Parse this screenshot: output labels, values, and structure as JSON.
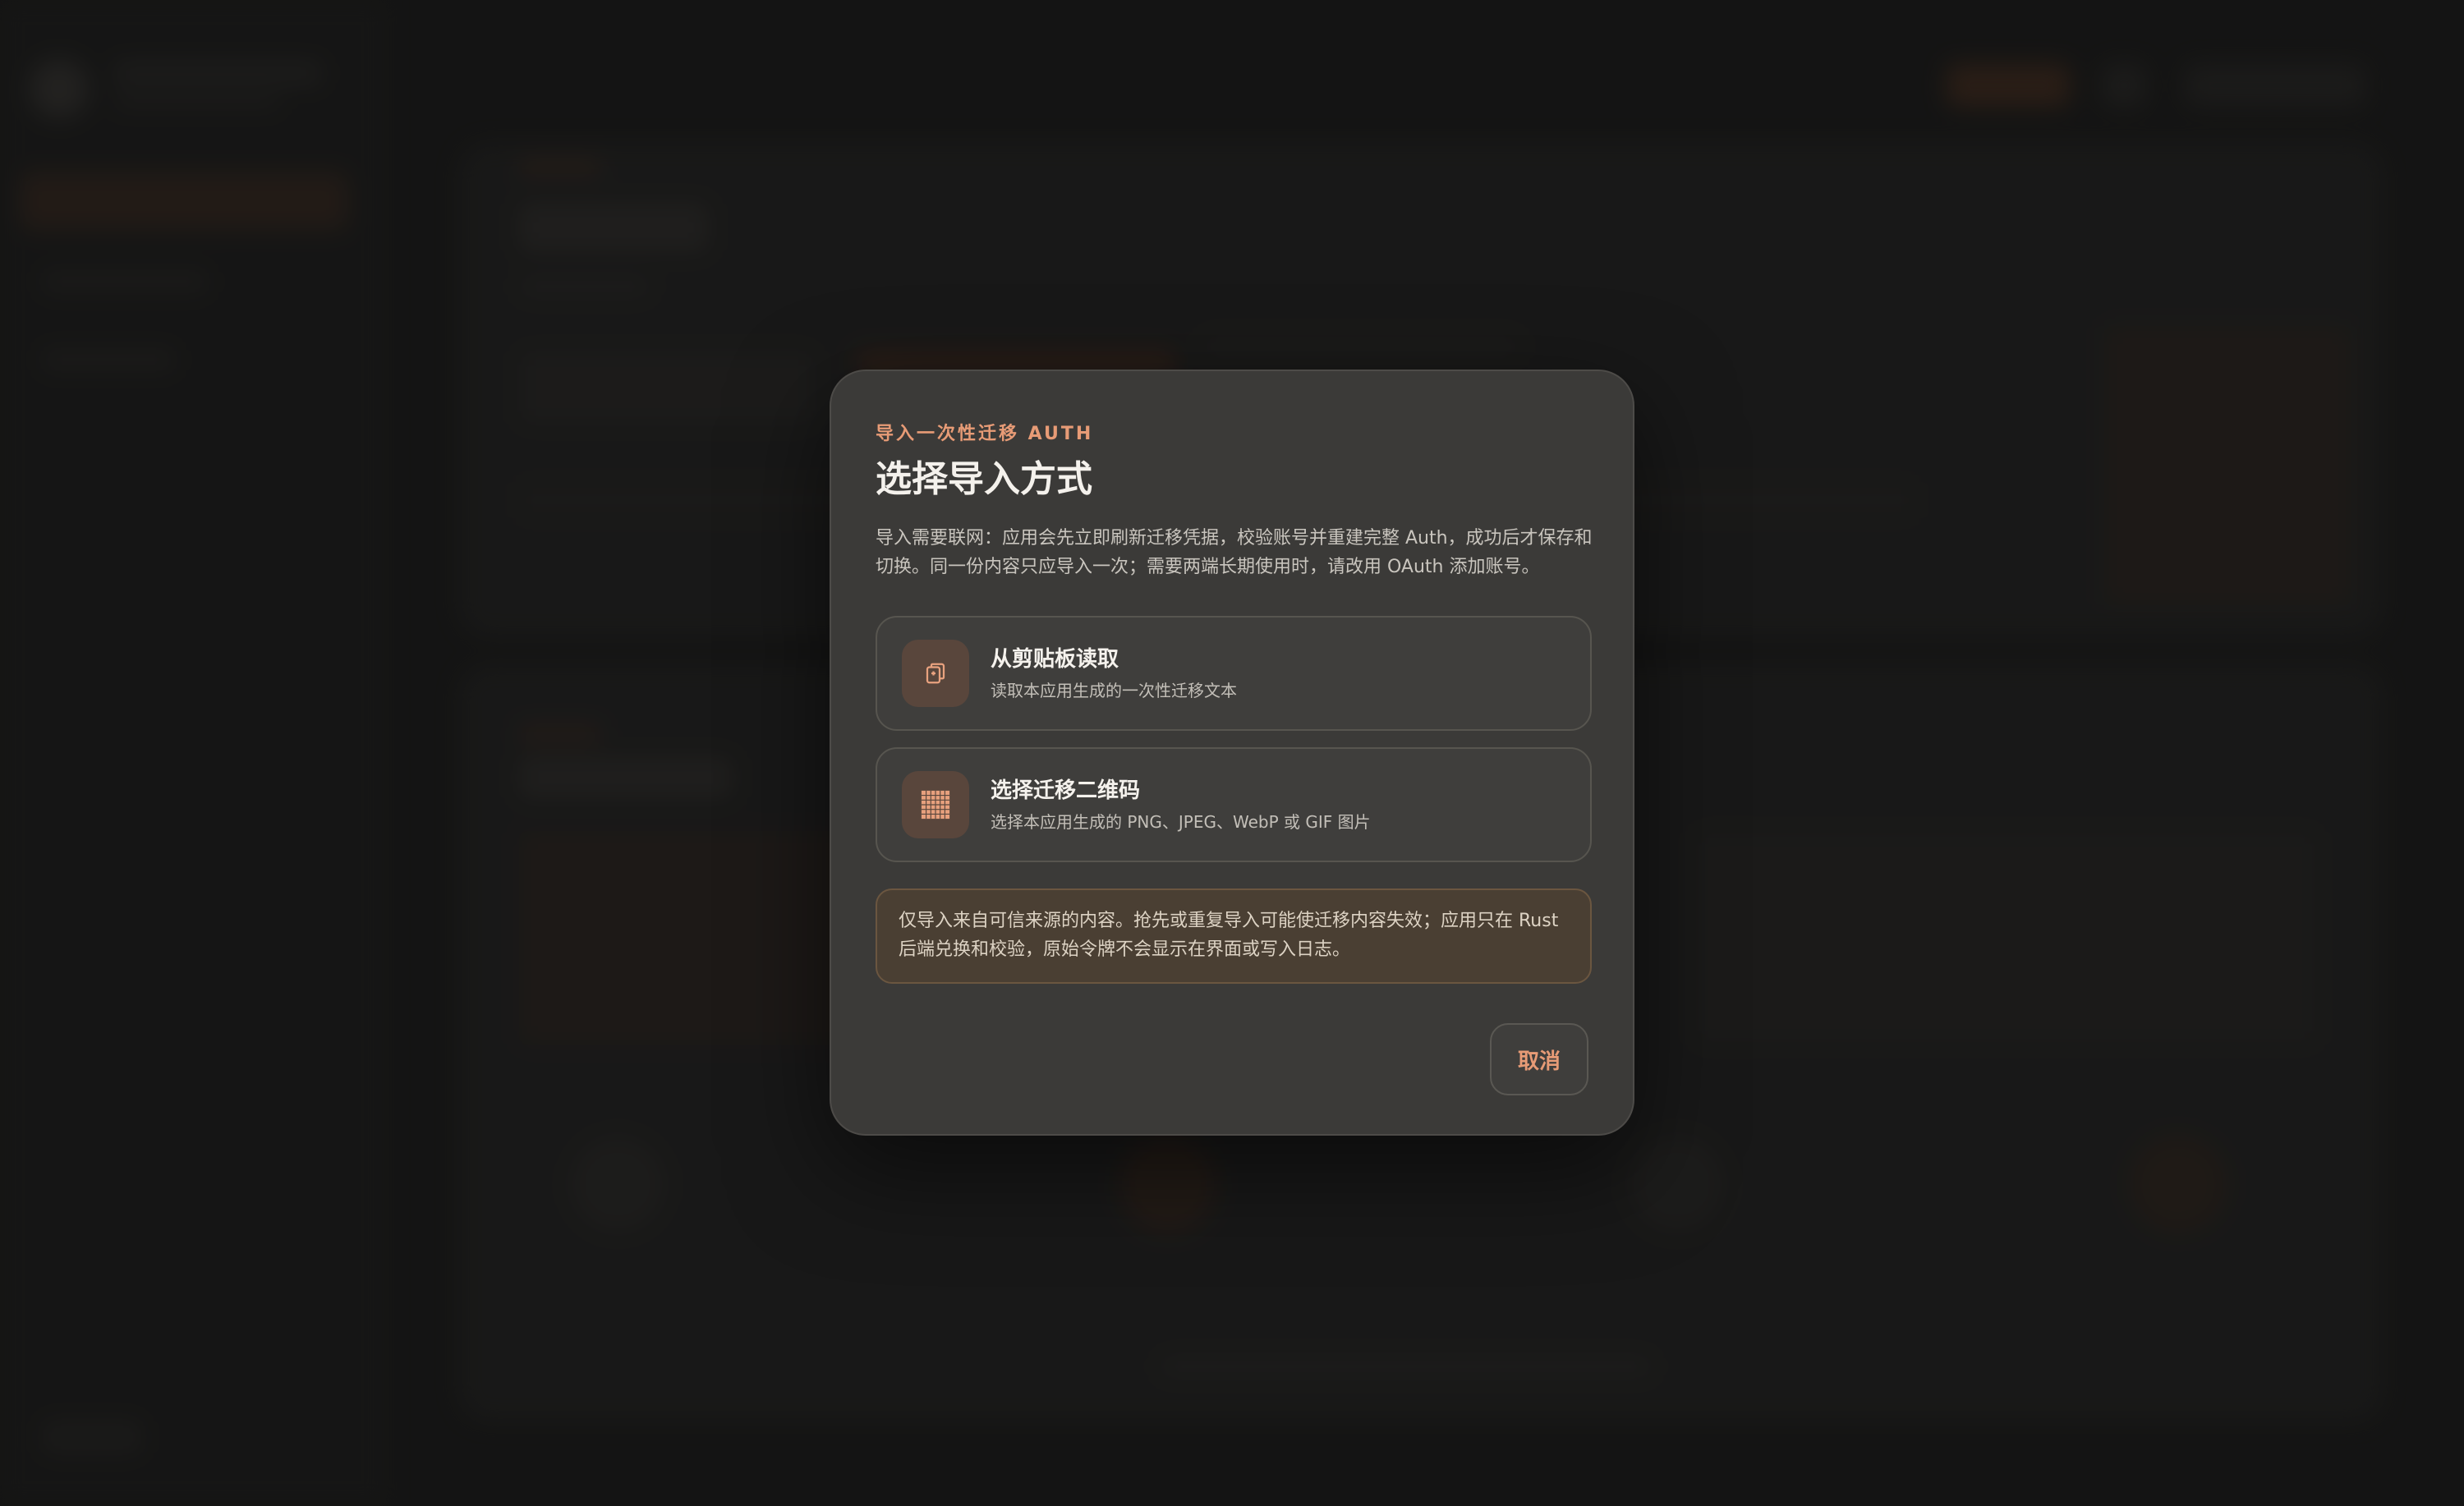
{
  "colors": {
    "accent": "#e79b76",
    "modal_bg": "#3b3a38",
    "page_bg": "#1b1b1a",
    "warning_bg": "#4a3f33"
  },
  "modal": {
    "eyebrow": "导入一次性迁移 AUTH",
    "title": "选择导入方式",
    "description": "导入需要联网：应用会先立即刷新迁移凭据，校验账号并重建完整 Auth，成功后才保存和切换。同一份内容只应导入一次；需要两端长期使用时，请改用 OAuth 添加账号。",
    "options": [
      {
        "icon": "clipboard-icon",
        "title": "从剪贴板读取",
        "subtitle": "读取本应用生成的一次性迁移文本"
      },
      {
        "icon": "qr-code-icon",
        "title": "选择迁移二维码",
        "subtitle": "选择本应用生成的 PNG、JPEG、WebP 或 GIF 图片"
      }
    ],
    "warning": "仅导入来自可信来源的内容。抢先或重复导入可能使迁移内容失效；应用只在 Rust 后端兑换和校验，原始令牌不会显示在界面或写入日志。",
    "cancel_label": "取消"
  }
}
